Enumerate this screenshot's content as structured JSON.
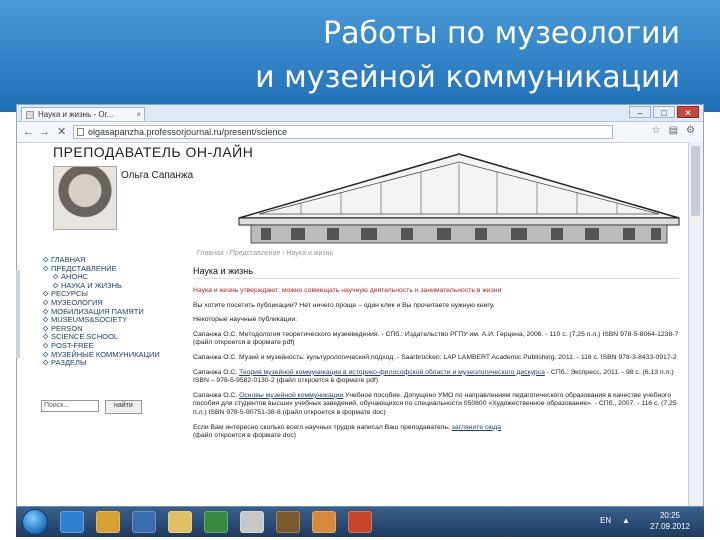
{
  "slide": {
    "title_line1": "Работы по музеологии",
    "title_line2": "и музейной коммуникации"
  },
  "browser": {
    "tab_title": "Наука и жизнь - Ог...",
    "tab_close": "×",
    "window_controls": [
      "–",
      "□",
      "✕"
    ],
    "back": "←",
    "forward": "→",
    "stop": "✕",
    "url": "olgasapanzha.professorjournal.ru/present/science"
  },
  "site": {
    "name": "ПРЕПОДАВАТЕЛЬ ОН-ЛАЙН",
    "author": "Ольга Сапанжа",
    "breadcrumbs": "Главная › Представление › Наука и жизнь",
    "nav": [
      {
        "label": "ГЛАВНАЯ",
        "sub": false
      },
      {
        "label": "ПРЕДСТАВЛЕНИЕ",
        "sub": false
      },
      {
        "label": "АНОНС",
        "sub": true
      },
      {
        "label": "НАУКА И ЖИЗНЬ",
        "sub": true
      },
      {
        "label": "РЕСУРСЫ",
        "sub": false
      },
      {
        "label": "МУЗЕОЛОГИЯ",
        "sub": false
      },
      {
        "label": "МОБИЛИЗАЦИЯ ПАМЯТИ",
        "sub": false
      },
      {
        "label": "MUSEUMS&SOCIETY",
        "sub": false
      },
      {
        "label": "PERSON",
        "sub": false
      },
      {
        "label": "SCIENCE SCHOOL",
        "sub": false
      },
      {
        "label": "POST-FREE",
        "sub": false
      },
      {
        "label": "МУЗЕЙНЫЕ КОММУНИКАЦИИ",
        "sub": false
      },
      {
        "label": "РАЗДЕЛЫ",
        "sub": false
      }
    ],
    "search_placeholder": "Поиск...",
    "search_button": "найти"
  },
  "article": {
    "heading": "Наука и жизнь",
    "notice": "Наука и жизнь утверждают: можно совмещать научную деятельность и занимательность в жизни",
    "question": "Вы хотите посетить публикации? Нет ничего проще – один клик и Вы прочитаете нужную книгу.",
    "intro": "Некоторые научные публикации:",
    "pubs": [
      {
        "link": "",
        "text": "Сапанжа О.С. Методология теоретического музееведения. - СПб.: Издательство РГПУ им. А.И. Герцена, 2006. - 110 с. (7,25 п.л.) ISBN 978-5-8064-1238-7 (файл откроется в формате pdf)"
      },
      {
        "link": "",
        "text": "Сапанжа О.С. Музей и музейность: культурологический подход. - Saarbrücken: LAP LAMBERT Academic Publishing, 2011. - 116 с. ISBN 978-3-8433-0917-2"
      },
      {
        "link": "Теория музейной коммуникации в историко-философской области и музеологического дискурса",
        "text": " - СПб.: Экспресс, 2011. - 98 с. (6,13 п.л.) ISBN – 978-5-9582-0130-2 (файл откроется в формате pdf)"
      },
      {
        "link": "Основы музейной коммуникации",
        "text": " Учебное пособие. Допущено УМО по направлениям педагогического образования в качестве учебного пособия для студентов высших учебных заведений, обучающихся по специальности 050600 «Художественное образование». - СПб., 2007. - 116 с. (7,25 п.л.) ISBN 978-5-90751-38-8 (файл откроется в формате doc)"
      }
    ],
    "pub_author_prefix": "Сапанжа О.С. ",
    "footer_text": "Если Вам интересно сколько всего научных трудов написал Ваш преподаватель, ",
    "footer_link": "загляните сюда",
    "footer_note": "(файл откроется в формате doc)"
  },
  "taskbar": {
    "lang": "EN",
    "tray_arrow": "▲",
    "time": "20:25",
    "date": "27.09.2012"
  },
  "colors": {
    "header_blue": "#2f80c4",
    "link": "#1b3f7a",
    "notice_red": "#b2241c",
    "taskbar": "#1d3b62"
  }
}
